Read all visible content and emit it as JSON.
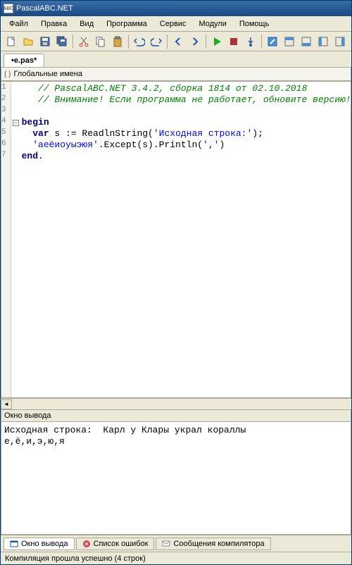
{
  "titlebar": {
    "icon_label": "ABC",
    "title": "PascalABC.NET"
  },
  "menu": {
    "items": [
      "Файл",
      "Правка",
      "Вид",
      "Программа",
      "Сервис",
      "Модули",
      "Помощь"
    ]
  },
  "tabs": {
    "active": "•e.pas*"
  },
  "breadcrumb": {
    "text": "Глобальные имена"
  },
  "code": {
    "gutter": [
      "1",
      "2",
      "3",
      "4",
      "5",
      "6",
      "7"
    ],
    "lines": [
      {
        "segments": [
          {
            "t": "   ",
            "c": ""
          },
          {
            "t": "// PascalABC.NET 3.4.2, сборка 1814 от 02.10.2018",
            "c": "c-comment"
          }
        ]
      },
      {
        "segments": [
          {
            "t": "   ",
            "c": ""
          },
          {
            "t": "// Внимание! Если программа не работает, обновите версию!",
            "c": "c-comment"
          }
        ]
      },
      {
        "segments": [
          {
            "t": "",
            "c": ""
          }
        ]
      },
      {
        "segments": [
          {
            "t": "begin",
            "c": "c-keyword"
          }
        ]
      },
      {
        "segments": [
          {
            "t": "  ",
            "c": ""
          },
          {
            "t": "var",
            "c": "c-keyword"
          },
          {
            "t": " s := ReadlnString(",
            "c": "c-text"
          },
          {
            "t": "'Исходная строка:'",
            "c": "c-string"
          },
          {
            "t": ");",
            "c": "c-text"
          }
        ]
      },
      {
        "segments": [
          {
            "t": "  ",
            "c": ""
          },
          {
            "t": "'аеёиоуыэюя'",
            "c": "c-string"
          },
          {
            "t": ".Except(s).Println(",
            "c": "c-text"
          },
          {
            "t": "','",
            "c": "c-string"
          },
          {
            "t": ")",
            "c": "c-text"
          }
        ]
      },
      {
        "segments": [
          {
            "t": "end",
            "c": "c-keyword"
          },
          {
            "t": ".",
            "c": "c-text"
          }
        ]
      }
    ]
  },
  "output": {
    "header": "Окно вывода",
    "body": "Исходная строка:  Карл у Клары украл кораллы\nе,ё,и,э,ю,я"
  },
  "bottom_tabs": {
    "items": [
      {
        "label": "Окно вывода",
        "icon": "window",
        "active": true
      },
      {
        "label": "Список ошибок",
        "icon": "error",
        "active": false
      },
      {
        "label": "Сообщения компилятора",
        "icon": "msg",
        "active": false
      }
    ]
  },
  "statusbar": {
    "text": "Компиляция прошла успешно (4 строк)"
  },
  "toolbar_icons": [
    "new",
    "open",
    "save",
    "saveall",
    "sep",
    "cut",
    "copy",
    "paste",
    "sep",
    "undo",
    "redo",
    "sep",
    "back",
    "fwd",
    "sep",
    "run",
    "stop",
    "stepinto",
    "sep",
    "panel1",
    "panel2",
    "panel3",
    "panel4",
    "panel5"
  ]
}
